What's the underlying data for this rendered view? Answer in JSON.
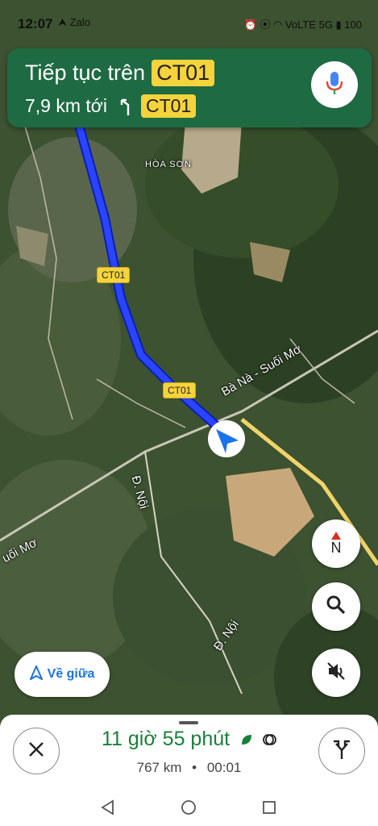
{
  "status_bar": {
    "time": "12:07",
    "left_icons": "⮝ Zalo",
    "right_icons": "⏰ ⦿ ◠ VoLTE 5G ▮ 100"
  },
  "banner": {
    "instruction": "Tiếp tục trên",
    "road": "CT01",
    "next_distance": "7,9 km tới",
    "next_road": "CT01",
    "bg_color": "#1e6a43"
  },
  "map": {
    "road_labels": [
      "CT01",
      "CT01"
    ],
    "place_label": "HÒA SƠN",
    "street_1": "Bà Nà - Suối Mơ",
    "street_2": "Đ. Nội",
    "street_3": "Đ. Nội",
    "street_4": "uối Mơ"
  },
  "controls": {
    "compass_letter": "N",
    "recenter_label": "Về giữa"
  },
  "trip": {
    "eta_duration": "11 giờ 55 phút",
    "distance": "767 km",
    "separator": "•",
    "arrival_time": "00:01",
    "accent_color": "#188038"
  }
}
